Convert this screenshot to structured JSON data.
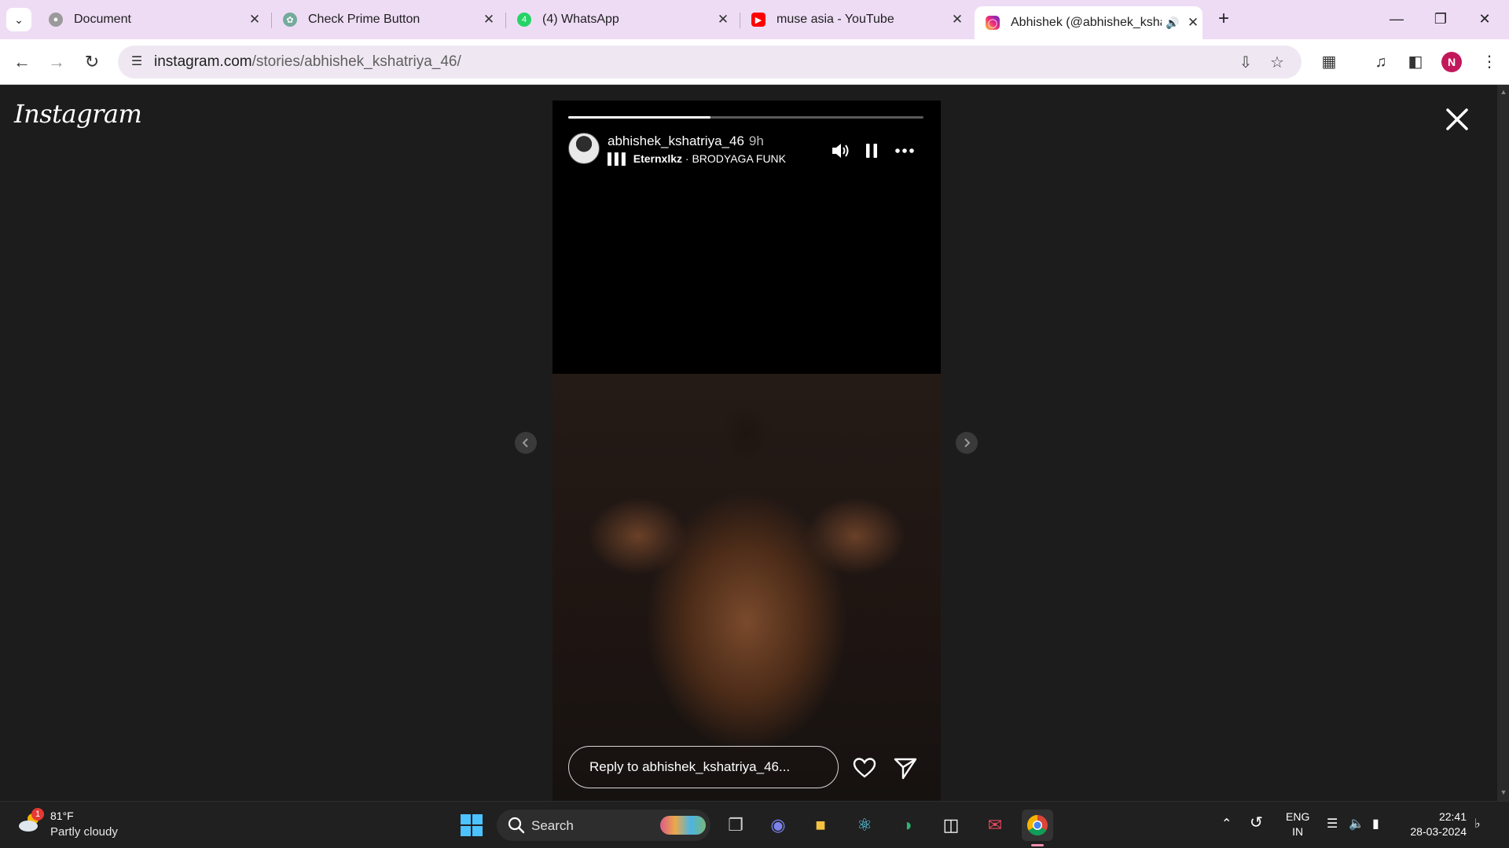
{
  "browser": {
    "tabs": [
      {
        "title": "Document",
        "favicon": "globe-icon",
        "color": "#8a8a8a"
      },
      {
        "title": "Check Prime Button",
        "favicon": "chatgpt-icon",
        "color": "#74aa9c"
      },
      {
        "title": "(4) WhatsApp",
        "favicon": "whatsapp-icon",
        "color": "#25d366"
      },
      {
        "title": "muse asia - YouTube",
        "favicon": "youtube-icon",
        "color": "#ff0000"
      },
      {
        "title": "Abhishek (@abhishek_kshat",
        "favicon": "instagram-icon",
        "color": "#e1306c",
        "active": true,
        "audio": true
      }
    ],
    "url_host": "instagram.com",
    "url_path": "/stories/abhishek_kshatriya_46/",
    "profile_initial": "N"
  },
  "instagram": {
    "logo": "Instagram",
    "story": {
      "username": "abhishek_kshatriya_46",
      "time": "9h",
      "music_artist": "Eternxlkz",
      "music_separator": " · ",
      "music_track": "BRODYAGA FUNK",
      "progress": 0.4,
      "reply_placeholder": "Reply to abhishek_kshatriya_46..."
    }
  },
  "taskbar": {
    "weather_temp": "81°F",
    "weather_desc": "Partly cloudy",
    "weather_badge": "1",
    "search_label": "Search",
    "lang_top": "ENG",
    "lang_bottom": "IN",
    "time": "22:41",
    "date": "28-03-2024"
  }
}
